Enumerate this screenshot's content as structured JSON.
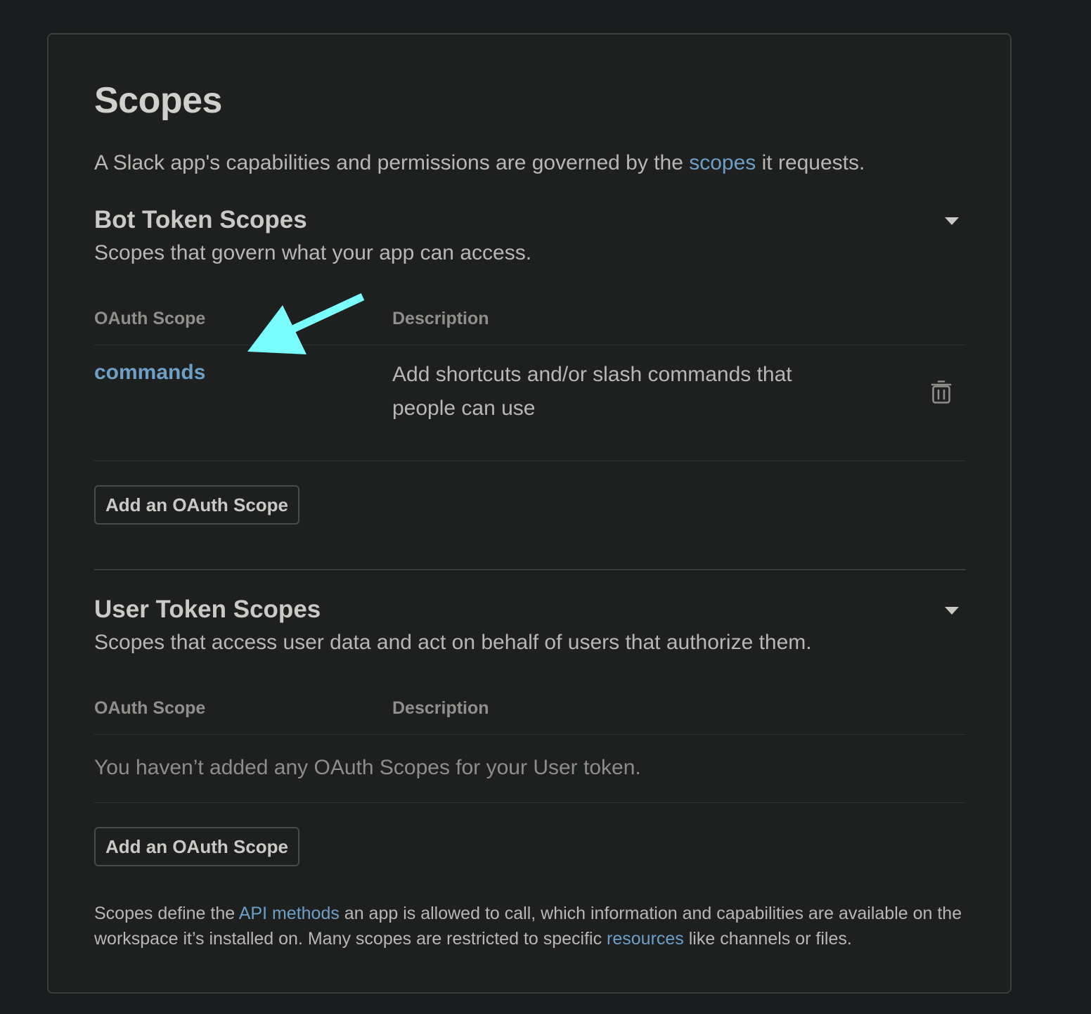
{
  "scopes": {
    "title": "Scopes",
    "intro": {
      "before": "A Slack app's capabilities and permissions are governed by the ",
      "link": "scopes",
      "after": " it requests."
    },
    "bot": {
      "title": "Bot Token Scopes",
      "subtitle": "Scopes that govern what your app can access.",
      "col_scope": "OAuth Scope",
      "col_description": "Description",
      "rows": [
        {
          "scope": "commands",
          "description": "Add shortcuts and/or slash commands that people can use"
        }
      ],
      "add_button": "Add an OAuth Scope"
    },
    "user": {
      "title": "User Token Scopes",
      "subtitle": "Scopes that access user data and act on behalf of users that authorize them.",
      "col_scope": "OAuth Scope",
      "col_description": "Description",
      "empty": "You haven’t added any OAuth Scopes for your User token.",
      "add_button": "Add an OAuth Scope"
    },
    "footer": {
      "part1": "Scopes define the ",
      "link1": "API methods",
      "part2": " an app is allowed to call, which information and capabilities are available on the workspace it’s installed on. Many scopes are restricted to specific ",
      "link2": "resources",
      "part3": " like channels or files."
    }
  },
  "annotation": {
    "arrow_color": "#79fdff"
  },
  "colors": {
    "background": "#1a1d1d",
    "card": "#1e1f1f",
    "link": "#6e9fc7"
  }
}
